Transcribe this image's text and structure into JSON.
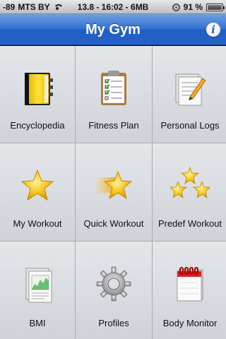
{
  "status_bar": {
    "signal": "-89",
    "carrier": "MTS BY",
    "center": "13.8 - 16:02 - 6MB",
    "battery_percent": "91 %",
    "battery_level": 0.91
  },
  "nav": {
    "title": "My Gym",
    "info_label": "i"
  },
  "tiles": [
    {
      "label": "Encyclopedia",
      "icon": "book-icon"
    },
    {
      "label": "Fitness Plan",
      "icon": "clipboard-checklist-icon"
    },
    {
      "label": "Personal Logs",
      "icon": "notes-pencil-icon"
    },
    {
      "label": "My Workout",
      "icon": "star-icon"
    },
    {
      "label": "Quick Workout",
      "icon": "fast-star-icon"
    },
    {
      "label": "Predef Workout",
      "icon": "three-stars-icon"
    },
    {
      "label": "BMI",
      "icon": "chart-document-icon"
    },
    {
      "label": "Profiles",
      "icon": "gear-icon"
    },
    {
      "label": "Body Monitor",
      "icon": "calendar-icon"
    }
  ],
  "colors": {
    "nav_blue": "#2f6fd0",
    "star_yellow": "#f7c51a",
    "book_yellow": "#f5d21a"
  }
}
